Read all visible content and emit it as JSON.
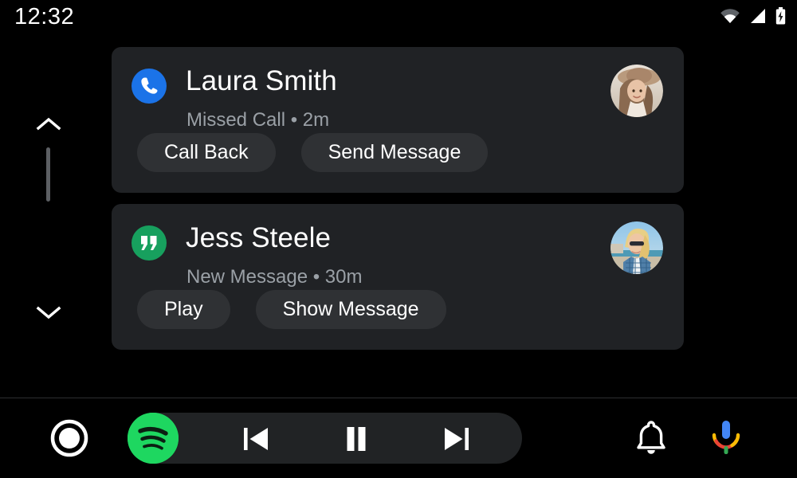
{
  "status_bar": {
    "clock": "12:32",
    "icons": [
      {
        "name": "wifi-icon",
        "label": "Wi-Fi"
      },
      {
        "name": "cellular-signal-icon",
        "label": "Cellular signal"
      },
      {
        "name": "battery-charging-icon",
        "label": "Battery charging"
      }
    ]
  },
  "scroll_rail": {
    "up_icon": "chevron-up-icon",
    "down_icon": "chevron-down-icon"
  },
  "notifications": [
    {
      "title": "Laura Smith",
      "subtitle": "Missed Call • 2m",
      "badge_icon": "phone-icon",
      "badge_color": "#1b73e8",
      "avatar_alt": "Laura Smith photo",
      "actions": [
        {
          "label": "Call Back",
          "name": "call-back-button"
        },
        {
          "label": "Send Message",
          "name": "send-message-button"
        }
      ]
    },
    {
      "title": "Jess Steele",
      "subtitle": "New Message • 30m",
      "badge_icon": "chat-quote-icon",
      "badge_color": "#17a05e",
      "avatar_alt": "Jess Steele photo",
      "actions": [
        {
          "label": "Play",
          "name": "play-button"
        },
        {
          "label": "Show Message",
          "name": "show-message-button"
        }
      ]
    }
  ],
  "bottom_bar": {
    "home_icon": "home-circle-icon",
    "media_app_icon": "spotify-icon",
    "media_app_color": "#1ed760",
    "controls": [
      {
        "name": "previous-track-button",
        "icon": "skip-previous-icon"
      },
      {
        "name": "pause-button",
        "icon": "pause-icon"
      },
      {
        "name": "next-track-button",
        "icon": "skip-next-icon"
      }
    ],
    "notifications_icon": "bell-icon",
    "assistant_icon": "google-assistant-mic-icon"
  },
  "colors": {
    "background": "#000000",
    "card": "#202225",
    "button": "#2f3134",
    "text_primary": "#ffffff",
    "text_secondary": "#9aa0a6",
    "accent_blue": "#1b73e8",
    "accent_green": "#17a05e",
    "spotify_green": "#1ed760"
  }
}
